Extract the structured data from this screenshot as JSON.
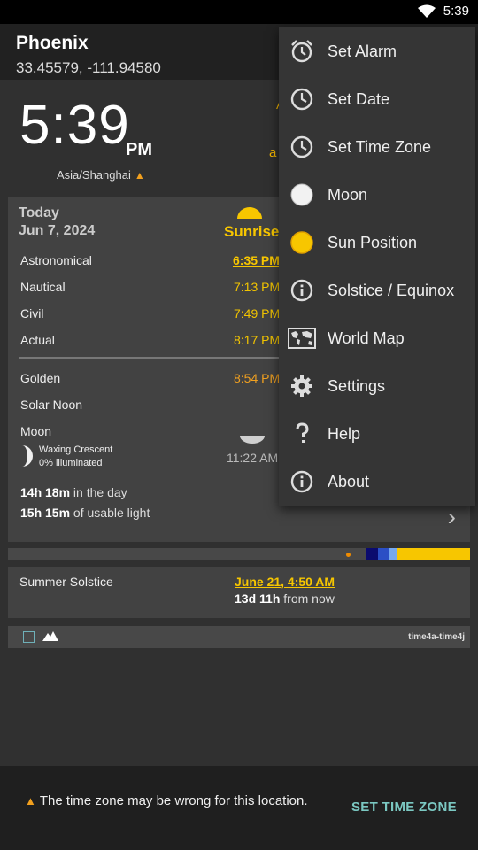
{
  "status_bar": {
    "time": "5:39"
  },
  "app_bar": {
    "title": "Phoenix",
    "coordinates": "33.45579, -111.94580"
  },
  "clock": {
    "time": "5:39",
    "ampm": "PM",
    "timezone": "Asia/Shanghai",
    "warning_icon": "warning-icon"
  },
  "peek": {
    "partial_1": "A",
    "partial_2": "a"
  },
  "today_card": {
    "today_label": "Today",
    "date": "Jun 7, 2024",
    "event_label": "Sunrise",
    "rows": [
      {
        "label": "Astronomical",
        "value": "6:35 PM"
      },
      {
        "label": "Nautical",
        "value": "7:13 PM"
      },
      {
        "label": "Civil",
        "value": "7:49 PM"
      },
      {
        "label": "Actual",
        "value": "8:17 PM"
      }
    ],
    "golden": {
      "label": "Golden",
      "value": "8:54 PM"
    },
    "solar_noon": {
      "label": "Solar Noon"
    },
    "moon": {
      "label": "Moon",
      "phase": "Waxing Crescent",
      "illumination": "0% illuminated",
      "time": "11:22 AM"
    },
    "day_length": {
      "value": "14h 18m",
      "suffix": " in the day"
    },
    "usable_light": {
      "value": "15h 15m",
      "suffix": " of usable light"
    }
  },
  "solstice": {
    "name": "Summer Solstice",
    "when": "June 21, 4:50 AM",
    "countdown_value": "13d 11h",
    "countdown_suffix": " from now"
  },
  "bottom_bar": {
    "version": "time4a-time4j"
  },
  "snackbar": {
    "message": "The time zone may be wrong for this location.",
    "action": "SET TIME ZONE"
  },
  "menu": {
    "items": [
      {
        "label": "Set Alarm",
        "icon": "alarm-icon"
      },
      {
        "label": "Set Date",
        "icon": "clock-icon"
      },
      {
        "label": "Set Time Zone",
        "icon": "clock-icon"
      },
      {
        "label": "Moon",
        "icon": "moon-icon"
      },
      {
        "label": "Sun Position",
        "icon": "sun-icon"
      },
      {
        "label": "Solstice / Equinox",
        "icon": "info-icon"
      },
      {
        "label": "World Map",
        "icon": "world-map-icon"
      },
      {
        "label": "Settings",
        "icon": "gear-icon"
      },
      {
        "label": "Help",
        "icon": "help-icon"
      },
      {
        "label": "About",
        "icon": "info-icon"
      }
    ]
  },
  "colors": {
    "accent": "#f7c600",
    "orange": "#f0a020",
    "teal": "#7bc8c2",
    "background": "#303030"
  }
}
